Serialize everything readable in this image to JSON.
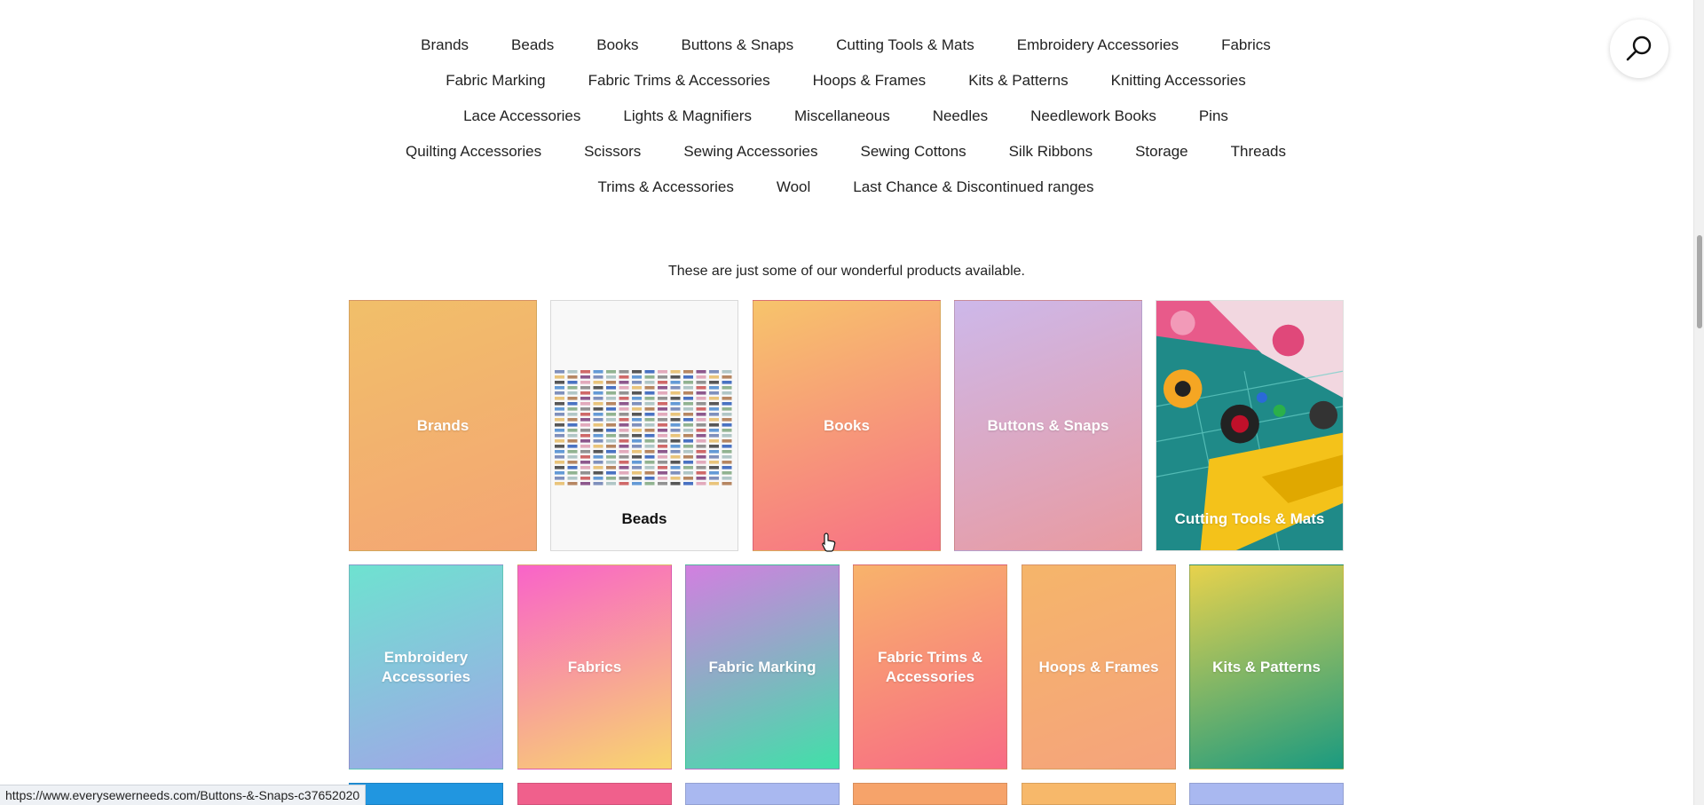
{
  "nav": {
    "rows": [
      [
        "Brands",
        "Beads",
        "Books",
        "Buttons & Snaps",
        "Cutting Tools & Mats",
        "Embroidery Accessories",
        "Fabrics"
      ],
      [
        "Fabric Marking",
        "Fabric Trims & Accessories",
        "Hoops & Frames",
        "Kits & Patterns",
        "Knitting Accessories"
      ],
      [
        "Lace Accessories",
        "Lights & Magnifiers",
        "Miscellaneous",
        "Needles",
        "Needlework Books",
        "Pins"
      ],
      [
        "Quilting Accessories",
        "Scissors",
        "Sewing Accessories",
        "Sewing Cottons",
        "Silk Ribbons",
        "Storage",
        "Threads"
      ],
      [
        "Trims & Accessories",
        "Wool",
        "Last Chance & Discontinued ranges"
      ]
    ]
  },
  "search": {
    "icon": "search-icon"
  },
  "tagline": "These are just some of our wonderful products available.",
  "tiles_row1": [
    {
      "label": "Brands",
      "gradient": [
        "#f1bf69",
        "#f4a574"
      ]
    },
    {
      "label": "Beads",
      "image": "bead-color-chart"
    },
    {
      "label": "Books",
      "gradient": [
        "#f7c46b",
        "#f76f86"
      ]
    },
    {
      "label": "Buttons & Snaps",
      "gradient": [
        "#cdb8ea",
        "#e99aa0"
      ]
    },
    {
      "label": "Cutting Tools & Mats",
      "image": "cutting-tools-photo"
    }
  ],
  "tiles_row2": [
    {
      "label": "Embroidery Accessories",
      "gradient": [
        "#6ee2d0",
        "#a2a4e8"
      ]
    },
    {
      "label": "Fabrics",
      "gradient": [
        "#f963c9",
        "#f8d66e"
      ]
    },
    {
      "label": "Fabric Marking",
      "gradient": [
        "#d27fe0",
        "#40e0a8"
      ]
    },
    {
      "label": "Fabric Trims & Accessories",
      "gradient": [
        "#f8b36b",
        "#f86b85"
      ]
    },
    {
      "label": "Hoops & Frames",
      "gradient": [
        "#f5b56a",
        "#f5a37c"
      ]
    },
    {
      "label": "Kits & Patterns",
      "gradient": [
        "#e8d24c",
        "#1a9a80"
      ]
    }
  ],
  "tiles_row3_colors": [
    "#2196e0",
    "#f0608c",
    "#a9b8f0",
    "#f6a36a",
    "#f7b86a",
    "#a9b8f0"
  ],
  "status_url": "https://www.everysewerneeds.com/Buttons-&-Snaps-c37652020"
}
